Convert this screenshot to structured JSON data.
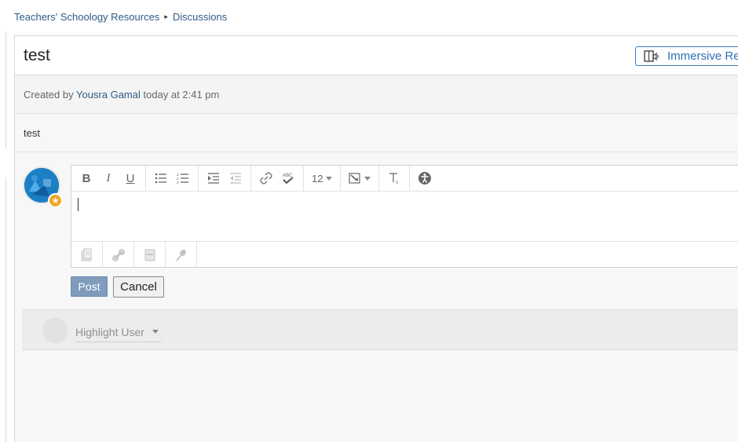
{
  "breadcrumb": {
    "course": "Teachers' Schoology Resources",
    "separator": "▸",
    "section": "Discussions"
  },
  "discussion": {
    "title": "test",
    "immersive_reader_label": "Immersive Re",
    "meta_prefix": "Created by",
    "author": "Yousra Gamal",
    "meta_time": "today at 2:41 pm",
    "body": "test"
  },
  "editor": {
    "font_size": "12",
    "toolbar_icons": [
      "bold-icon",
      "italic-icon",
      "underline-icon",
      "bullet-list-icon",
      "numbered-list-icon",
      "indent-icon",
      "outdent-icon",
      "link-icon",
      "spellcheck-icon",
      "font-size-select",
      "insert-icon",
      "clear-format-icon",
      "accessibility-icon"
    ],
    "attach_icons": [
      "file-icon",
      "link-attach-icon",
      "resource-icon",
      "microphone-icon"
    ]
  },
  "actions": {
    "post_label": "Post",
    "cancel_label": "Cancel"
  },
  "highlight": {
    "label": "Highlight User"
  },
  "colors": {
    "link": "#2f5c85",
    "accent": "#3b7bbf",
    "post_button": "#7f9cbd",
    "avatar": "#1c7fc4",
    "badge": "#f2a624"
  }
}
